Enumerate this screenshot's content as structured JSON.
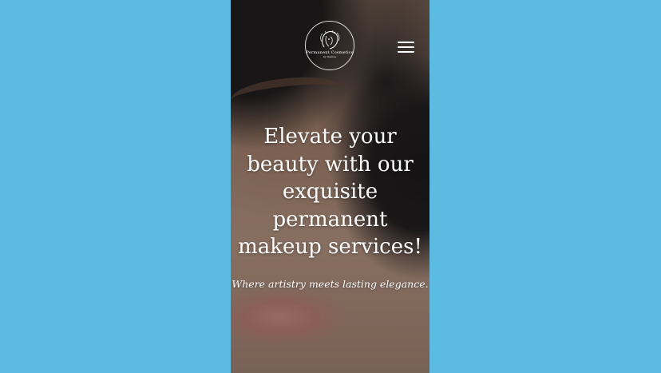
{
  "page": {
    "background_color": "#5bbbe0"
  },
  "header": {
    "logo": {
      "title": "Permanent Cosmetics",
      "subtitle": "by Desiree",
      "icon": "woman-face-logo-icon"
    },
    "menu_icon": "hamburger-menu-icon"
  },
  "hero": {
    "headline_lines": [
      "Elevate your",
      "beauty with our",
      "exquisite",
      "permanent",
      "makeup services!"
    ],
    "tagline": "Where artistry meets lasting elegance.",
    "text_color": "#ffffff"
  }
}
